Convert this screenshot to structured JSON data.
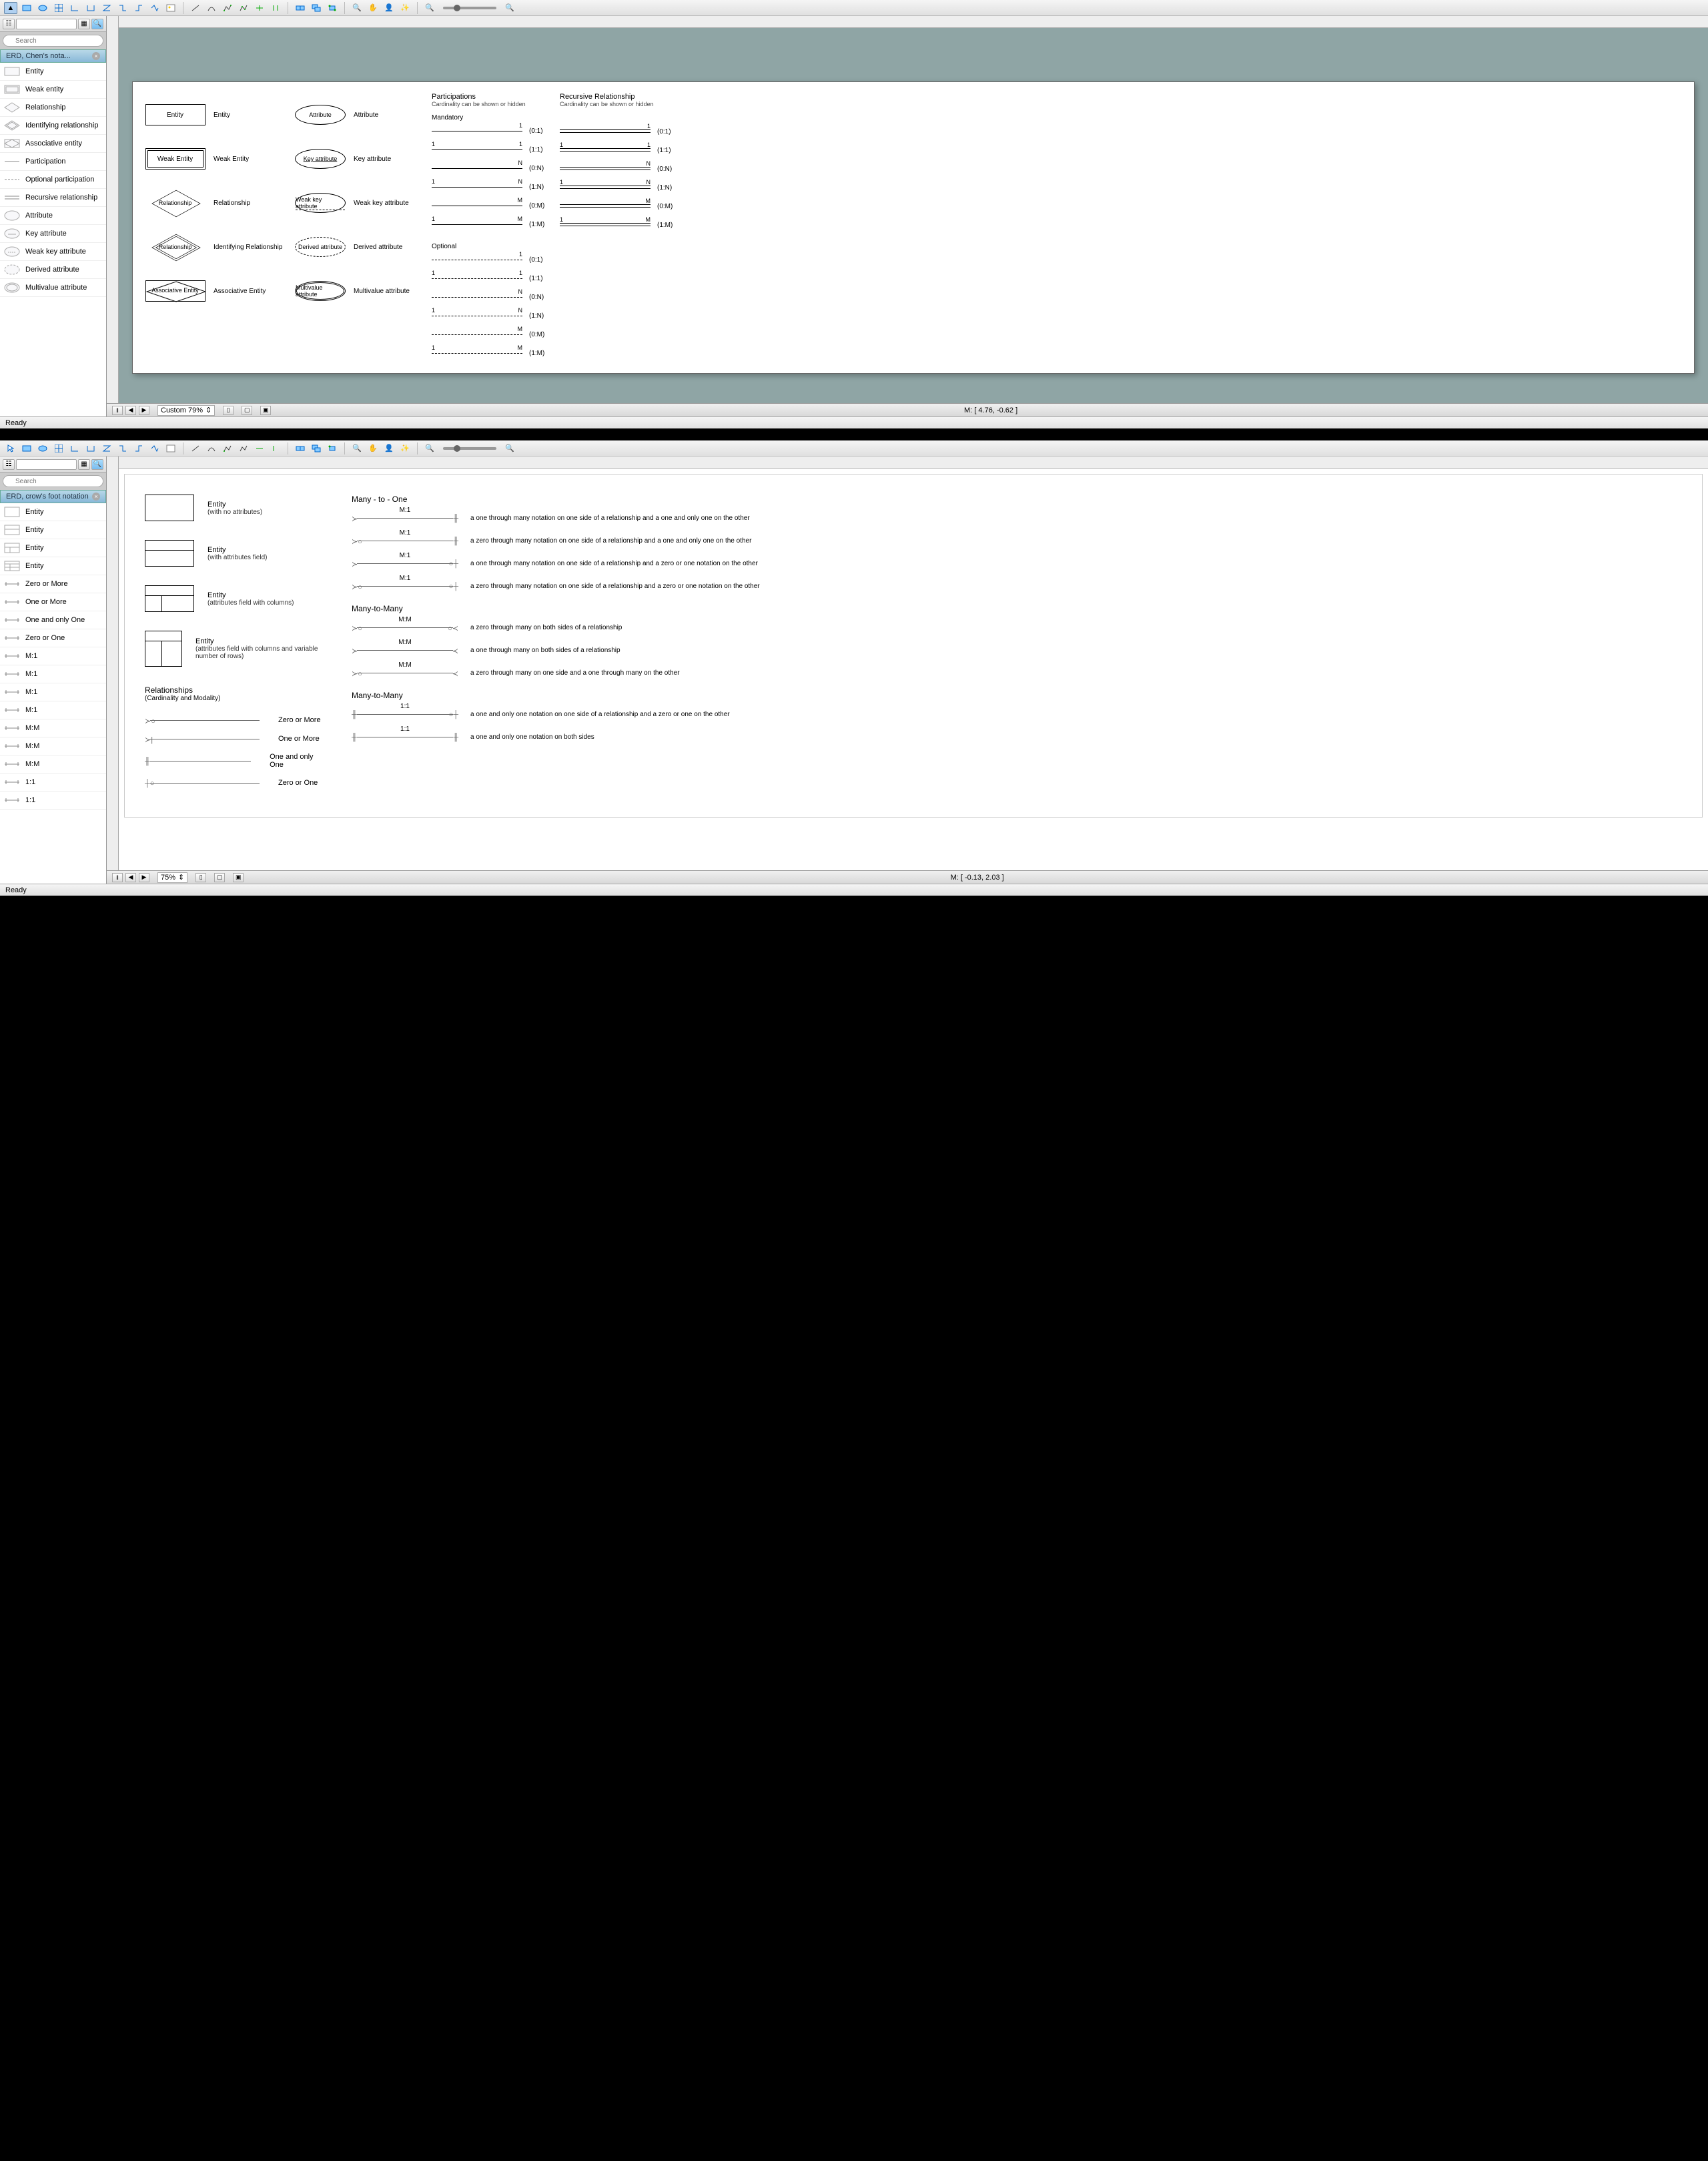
{
  "app1": {
    "toolbar_icons": [
      "cursor",
      "rect",
      "ellipse",
      "grid",
      "angle-L",
      "angle-U",
      "angle-Z",
      "angle-S",
      "connector1",
      "connector2",
      "image",
      "line",
      "arc",
      "poly1",
      "poly2",
      "poly3",
      "poly4",
      "group1",
      "group2",
      "group3",
      "zoom-in",
      "hand",
      "user",
      "wand",
      "zoom-out-small",
      "zoom-in-small"
    ],
    "search_placeholder": "Search",
    "panel_title": "ERD, Chen's nota...",
    "palette": [
      {
        "label": "Entity",
        "icon": "rect"
      },
      {
        "label": "Weak entity",
        "icon": "dblrect"
      },
      {
        "label": "Relationship",
        "icon": "diamond"
      },
      {
        "label": "Identifying relationship",
        "icon": "dbldiamond"
      },
      {
        "label": "Associative entity",
        "icon": "rectdiamond"
      },
      {
        "label": "Participation",
        "icon": "line"
      },
      {
        "label": "Optional participation",
        "icon": "dashline"
      },
      {
        "label": "Recursive relationship",
        "icon": "dblline"
      },
      {
        "label": "Attribute",
        "icon": "oval"
      },
      {
        "label": "Key attribute",
        "icon": "ovalkey"
      },
      {
        "label": "Weak key attribute",
        "icon": "ovalweak"
      },
      {
        "label": "Derived attribute",
        "icon": "dashoval"
      },
      {
        "label": "Multivalue attribute",
        "icon": "dbloval"
      }
    ],
    "page": {
      "rows": [
        {
          "shape": "entity",
          "shape_text": "Entity",
          "label": "Entity",
          "attr_shape": "oval",
          "attr_text": "Attribute",
          "attr_label": "Attribute"
        },
        {
          "shape": "weak-entity",
          "shape_text": "Weak Entity",
          "label": "Weak Entity",
          "attr_shape": "oval",
          "attr_text": "Key attribute",
          "attr_label": "Key attribute",
          "attr_underline": true
        },
        {
          "shape": "diamond",
          "shape_text": "Relationship",
          "label": "Relationship",
          "attr_shape": "oval",
          "attr_text": "Weak key attribute",
          "attr_label": "Weak key attribute",
          "attr_dashunder": true
        },
        {
          "shape": "dbl-diamond",
          "shape_text": "Relationship",
          "label": "Identifying Relationship",
          "attr_shape": "dash-oval",
          "attr_text": "Derived attribute",
          "attr_label": "Derived attribute"
        },
        {
          "shape": "assoc",
          "shape_text": "Associative Entity",
          "label": "Associative Entity",
          "attr_shape": "dbl-oval",
          "attr_text": "Multivalue attribute",
          "attr_label": "Multivalue attribute"
        }
      ],
      "participations": {
        "title": "Participations",
        "subtitle": "Cardinality can be shown or hidden",
        "mandatory_label": "Mandatory",
        "mandatory": [
          {
            "left": "",
            "right": "1",
            "ratio": "(0:1)"
          },
          {
            "left": "1",
            "right": "1",
            "ratio": "(1:1)"
          },
          {
            "left": "",
            "right": "N",
            "ratio": "(0:N)"
          },
          {
            "left": "1",
            "right": "N",
            "ratio": "(1:N)"
          },
          {
            "left": "",
            "right": "M",
            "ratio": "(0:M)"
          },
          {
            "left": "1",
            "right": "M",
            "ratio": "(1:M)"
          }
        ],
        "optional_label": "Optional",
        "optional": [
          {
            "left": "",
            "right": "1",
            "ratio": "(0:1)"
          },
          {
            "left": "1",
            "right": "1",
            "ratio": "(1:1)"
          },
          {
            "left": "",
            "right": "N",
            "ratio": "(0:N)"
          },
          {
            "left": "1",
            "right": "N",
            "ratio": "(1:N)"
          },
          {
            "left": "",
            "right": "M",
            "ratio": "(0:M)"
          },
          {
            "left": "1",
            "right": "M",
            "ratio": "(1:M)"
          }
        ]
      },
      "recursive": {
        "title": "Recursive Relationship",
        "subtitle": "Cardinality can be shown or hidden",
        "rows": [
          {
            "left": "",
            "right": "1",
            "ratio": "(0:1)"
          },
          {
            "left": "1",
            "right": "1",
            "ratio": "(1:1)"
          },
          {
            "left": "",
            "right": "N",
            "ratio": "(0:N)"
          },
          {
            "left": "1",
            "right": "N",
            "ratio": "(1:N)"
          },
          {
            "left": "",
            "right": "M",
            "ratio": "(0:M)"
          },
          {
            "left": "1",
            "right": "M",
            "ratio": "(1:M)"
          }
        ]
      }
    },
    "status": {
      "zoom": "Custom 79%",
      "mouse": "M: [ 4.76, -0.62 ]",
      "ready": "Ready"
    }
  },
  "app2": {
    "search_placeholder": "Search",
    "panel_title": "ERD, crow's foot notation",
    "palette": [
      {
        "label": "Entity"
      },
      {
        "label": "Entity"
      },
      {
        "label": "Entity"
      },
      {
        "label": "Entity"
      },
      {
        "label": "Zero or More"
      },
      {
        "label": "One or More"
      },
      {
        "label": "One and only One"
      },
      {
        "label": "Zero or One"
      },
      {
        "label": "M:1"
      },
      {
        "label": "M:1"
      },
      {
        "label": "M:1"
      },
      {
        "label": "M:1"
      },
      {
        "label": "M:M"
      },
      {
        "label": "M:M"
      },
      {
        "label": "M:M"
      },
      {
        "label": "1:1"
      },
      {
        "label": "1:1"
      }
    ],
    "page": {
      "entities": [
        {
          "title": "Entity",
          "sub": "(with no attributes)"
        },
        {
          "title": "Entity",
          "sub": "(with attributes field)"
        },
        {
          "title": "Entity",
          "sub": "(attributes field with columns)"
        },
        {
          "title": "Entity",
          "sub": "(attributes field with columns and variable number of rows)"
        }
      ],
      "rel_title": "Relationships",
      "rel_sub": "(Cardinality and Modality)",
      "rel_lines": [
        {
          "label": "Zero or More"
        },
        {
          "label": "One or More"
        },
        {
          "label": "One and only One"
        },
        {
          "label": "Zero or One"
        }
      ],
      "sections": [
        {
          "title": "Many - to - One",
          "rows": [
            {
              "label": "M:1",
              "desc": "a one through many notation on one side of a relationship and a one and only one on the other"
            },
            {
              "label": "M:1",
              "desc": "a zero through many notation on one side of a relationship and a one and only one on the other"
            },
            {
              "label": "M:1",
              "desc": "a one through many notation on one side of a relationship and a zero or one notation on the other"
            },
            {
              "label": "M:1",
              "desc": "a zero through many notation on one side of a relationship and a zero or one notation on the other"
            }
          ]
        },
        {
          "title": "Many-to-Many",
          "rows": [
            {
              "label": "M:M",
              "desc": "a zero through many on both sides of a relationship"
            },
            {
              "label": "M:M",
              "desc": "a one through many on both sides of a relationship"
            },
            {
              "label": "M:M",
              "desc": "a zero through many on one side and a one through many on the other"
            }
          ]
        },
        {
          "title": "Many-to-Many",
          "rows": [
            {
              "label": "1:1",
              "desc": "a one and only one notation on one side of a relationship and a zero or one on the other"
            },
            {
              "label": "1:1",
              "desc": "a one and only one notation on both sides"
            }
          ]
        }
      ]
    },
    "status": {
      "zoom": "75%",
      "mouse": "M: [ -0.13, 2.03 ]",
      "ready": "Ready"
    }
  }
}
